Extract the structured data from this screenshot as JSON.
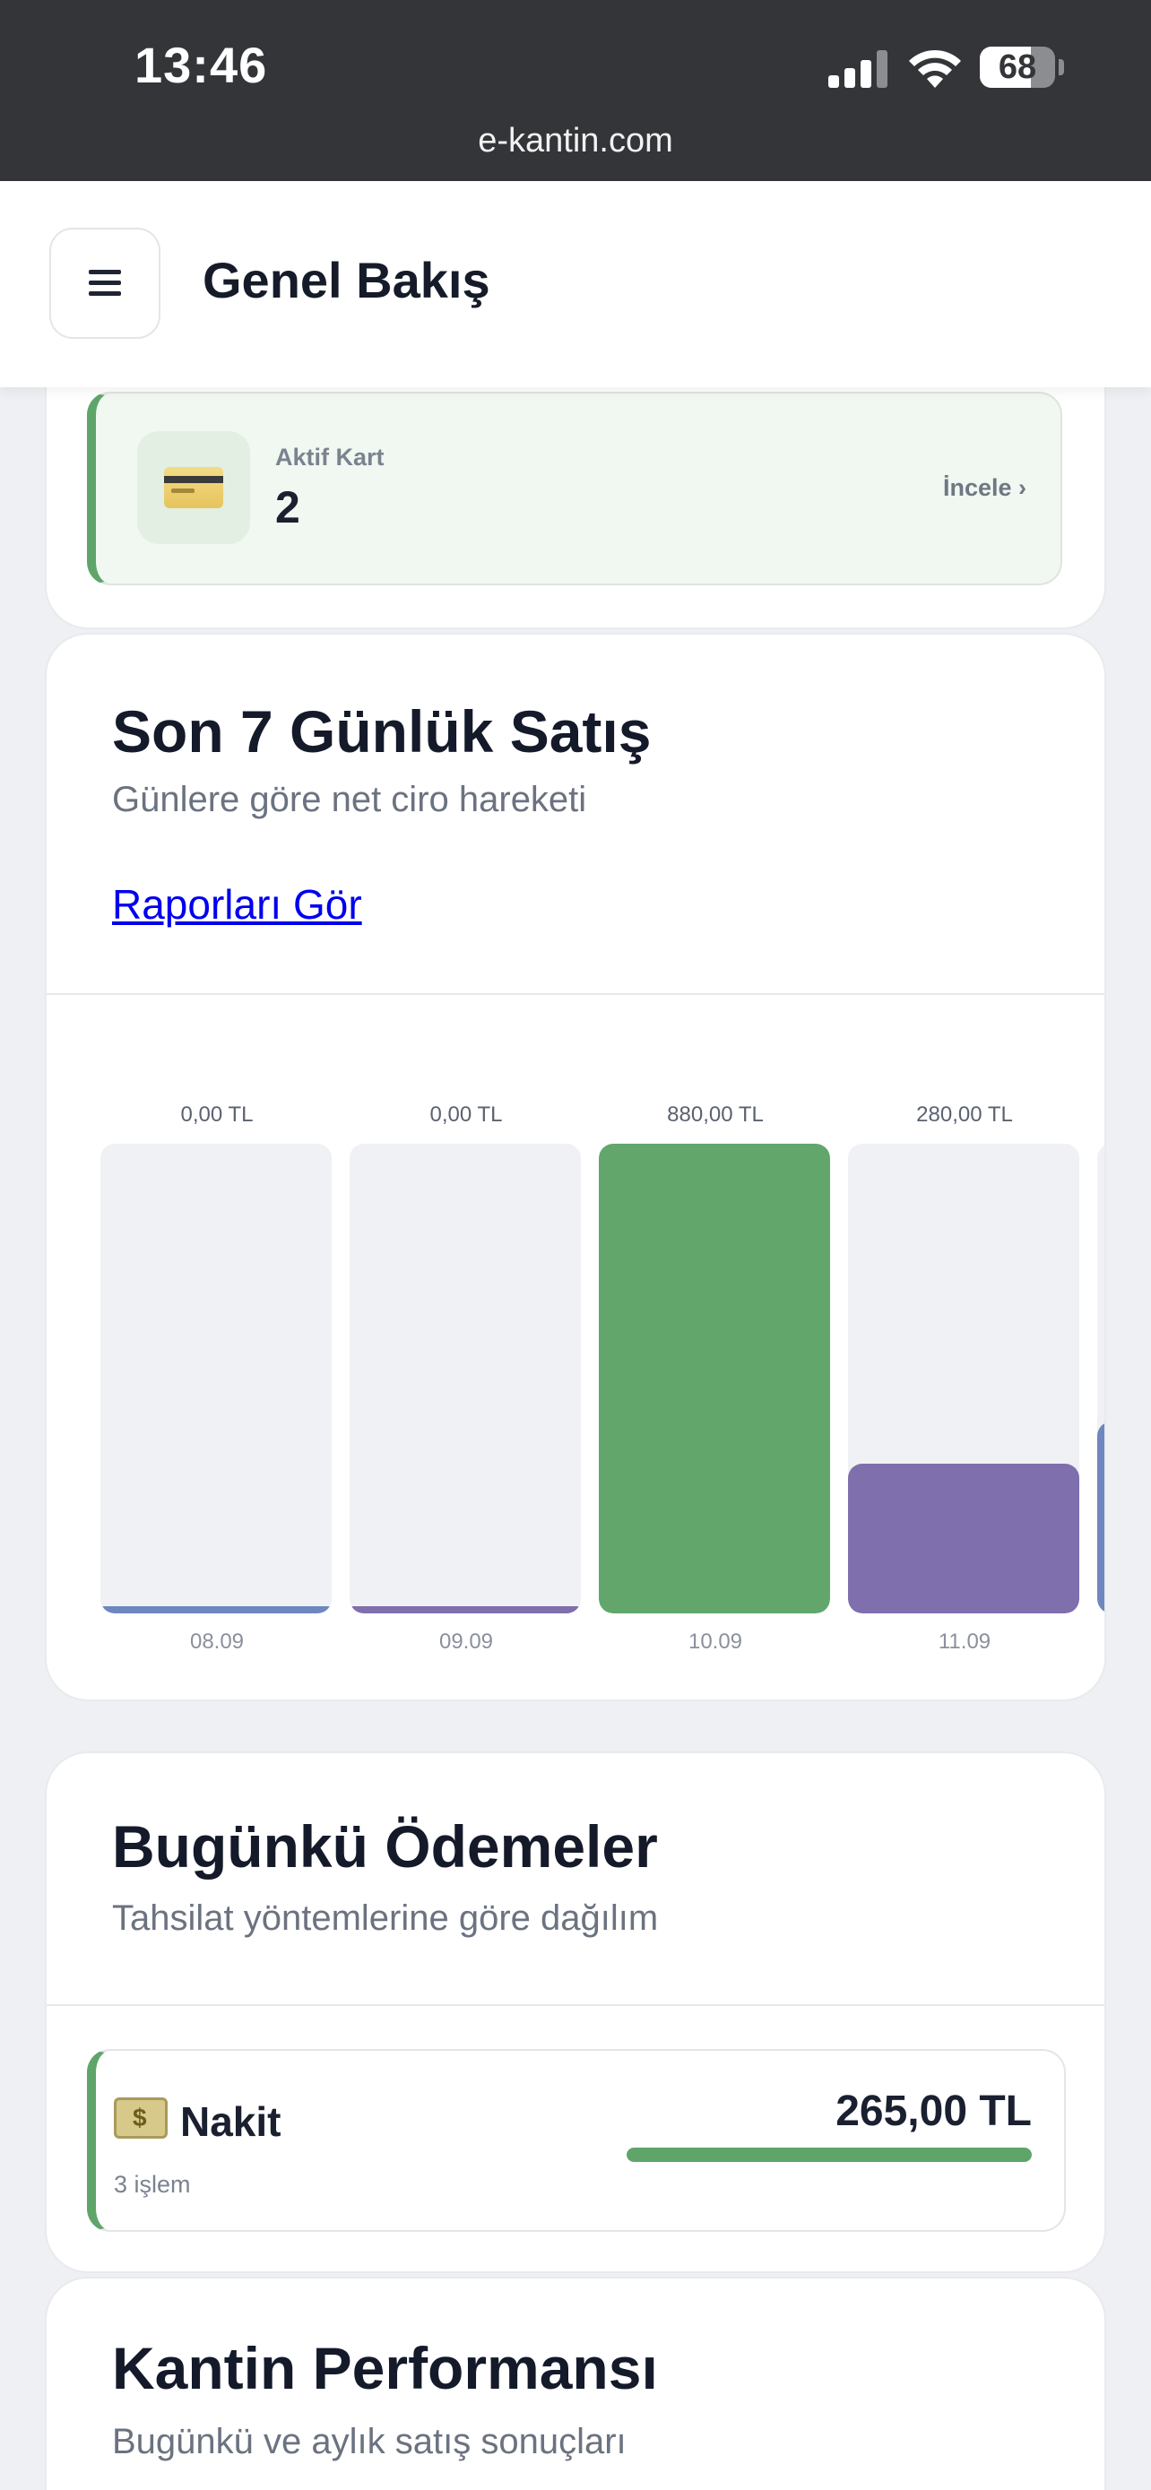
{
  "status_bar": {
    "time": "13:46",
    "battery": "68",
    "url": "e-kantin.com",
    "icons": [
      "signal-icon",
      "wifi-icon",
      "battery-icon"
    ]
  },
  "header": {
    "title": "Genel Bakış",
    "menu_icon": "hamburger-icon"
  },
  "stat_card": {
    "label": "Aktif Kart",
    "value": "2",
    "link": "İncele ›",
    "icon": "credit-card-icon"
  },
  "sales": {
    "title": "Son 7 Günlük Satış",
    "subtitle": "Günlere göre net ciro hareketi",
    "link": "Raporları Gör"
  },
  "chart_data": {
    "type": "bar",
    "categories": [
      "08.09",
      "09.09",
      "10.09",
      "11.09"
    ],
    "values": [
      0,
      0,
      880,
      280
    ],
    "value_labels": [
      "0,00 TL",
      "0,00 TL",
      "880,00 TL",
      "280,00 TL"
    ],
    "ylim": [
      0,
      880
    ],
    "colors": [
      "#6f87bf",
      "#7f6fad",
      "#62a66c",
      "#7f6fad"
    ],
    "partial_next_bar": {
      "value": 360,
      "color": "#6f87bf"
    },
    "grid": false
  },
  "payments": {
    "title": "Bugünkü Ödemeler",
    "subtitle": "Tahsilat yöntemlerine göre dağılım",
    "items": [
      {
        "label": "Nakit",
        "count": "3 işlem",
        "amount": "265,00 TL",
        "share": 1.0,
        "icon": "money-icon",
        "color": "#5fa56a"
      }
    ]
  },
  "performance": {
    "title": "Kantin Performansı",
    "subtitle": "Bugünkü ve aylık satış sonuçları"
  }
}
